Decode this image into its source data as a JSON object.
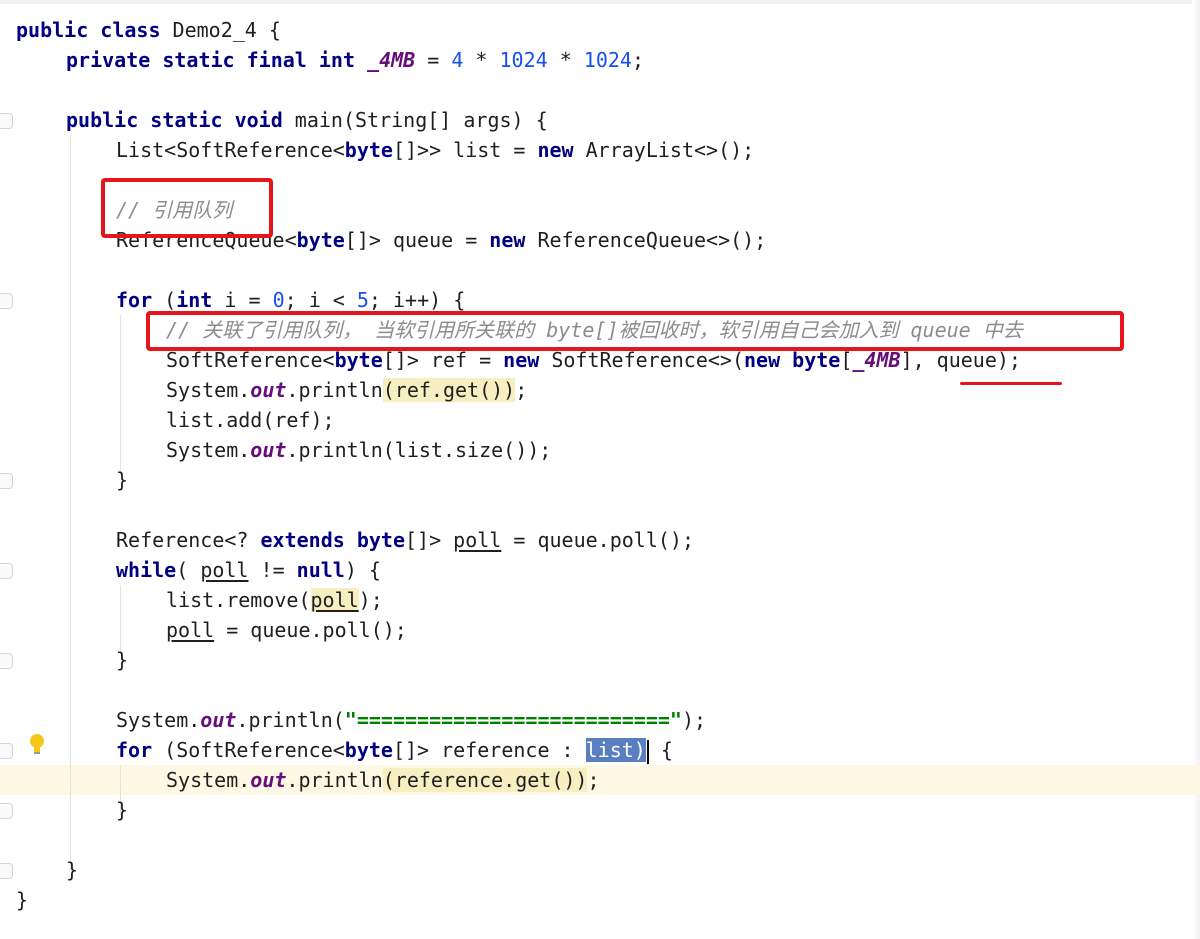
{
  "editor": {
    "language": "java",
    "current_line": 25,
    "lines": [
      {
        "tokens": [
          {
            "t": "public class",
            "c": "kw"
          },
          {
            "t": " Demo2_4 {"
          }
        ]
      },
      {
        "indent": 1,
        "tokens": [
          {
            "t": "private static final int",
            "c": "kw"
          },
          {
            "t": " "
          },
          {
            "t": "_4MB",
            "c": "const"
          },
          {
            "t": " = "
          },
          {
            "t": "4",
            "c": "num"
          },
          {
            "t": " * "
          },
          {
            "t": "1024",
            "c": "num"
          },
          {
            "t": " * "
          },
          {
            "t": "1024",
            "c": "num"
          },
          {
            "t": ";"
          }
        ]
      },
      {
        "tokens": []
      },
      {
        "indent": 1,
        "tokens": [
          {
            "t": "public static void",
            "c": "kw"
          },
          {
            "t": " main(String[] args) {"
          }
        ]
      },
      {
        "indent": 2,
        "tokens": [
          {
            "t": "List<SoftReference<"
          },
          {
            "t": "byte",
            "c": "kw"
          },
          {
            "t": "[]>> list = "
          },
          {
            "t": "new",
            "c": "kw"
          },
          {
            "t": " ArrayList<>();"
          }
        ]
      },
      {
        "tokens": []
      },
      {
        "indent": 2,
        "tokens": [
          {
            "t": "// 引用队列",
            "c": "comment"
          }
        ]
      },
      {
        "indent": 2,
        "tokens": [
          {
            "t": "ReferenceQueue<"
          },
          {
            "t": "byte",
            "c": "kw"
          },
          {
            "t": "[]> queue = "
          },
          {
            "t": "new",
            "c": "kw"
          },
          {
            "t": " ReferenceQueue<>();"
          }
        ]
      },
      {
        "tokens": []
      },
      {
        "indent": 2,
        "tokens": [
          {
            "t": "for",
            "c": "kw"
          },
          {
            "t": " ("
          },
          {
            "t": "int",
            "c": "kw"
          },
          {
            "t": " i = "
          },
          {
            "t": "0",
            "c": "num"
          },
          {
            "t": "; i < "
          },
          {
            "t": "5",
            "c": "num"
          },
          {
            "t": "; i++) {"
          }
        ]
      },
      {
        "indent": 3,
        "tokens": [
          {
            "t": "// 关联了引用队列， 当软引用所关联的 byte[]被回收时，软引用自己会加入到 queue 中去",
            "c": "comment"
          }
        ]
      },
      {
        "indent": 3,
        "tokens": [
          {
            "t": "SoftReference<"
          },
          {
            "t": "byte",
            "c": "kw"
          },
          {
            "t": "[]> ref = "
          },
          {
            "t": "new",
            "c": "kw"
          },
          {
            "t": " SoftReference<>("
          },
          {
            "t": "new",
            "c": "kw"
          },
          {
            "t": " "
          },
          {
            "t": "byte",
            "c": "kw"
          },
          {
            "t": "["
          },
          {
            "t": "_4MB",
            "c": "const"
          },
          {
            "t": "], queue);"
          }
        ]
      },
      {
        "indent": 3,
        "tokens": [
          {
            "t": "System."
          },
          {
            "t": "out",
            "c": "static-field"
          },
          {
            "t": ".println"
          },
          {
            "t": "(ref.get())",
            "c": "hl"
          },
          {
            "t": ";"
          }
        ]
      },
      {
        "indent": 3,
        "tokens": [
          {
            "t": "list.add(ref);"
          }
        ]
      },
      {
        "indent": 3,
        "tokens": [
          {
            "t": "System."
          },
          {
            "t": "out",
            "c": "static-field"
          },
          {
            "t": ".println(list.size());"
          }
        ]
      },
      {
        "indent": 2,
        "tokens": [
          {
            "t": "}"
          }
        ]
      },
      {
        "tokens": []
      },
      {
        "indent": 2,
        "tokens": [
          {
            "t": "Reference<? "
          },
          {
            "t": "extends byte",
            "c": "kw"
          },
          {
            "t": "[]> "
          },
          {
            "t": "poll",
            "c": "under"
          },
          {
            "t": " = queue.poll();"
          }
        ]
      },
      {
        "indent": 2,
        "tokens": [
          {
            "t": "while",
            "c": "kw"
          },
          {
            "t": "( "
          },
          {
            "t": "poll",
            "c": "under"
          },
          {
            "t": " != "
          },
          {
            "t": "null",
            "c": "kw"
          },
          {
            "t": ") {"
          }
        ]
      },
      {
        "indent": 3,
        "tokens": [
          {
            "t": "list.remove("
          },
          {
            "t": "poll",
            "c": "under hl"
          },
          {
            "t": ");"
          }
        ]
      },
      {
        "indent": 3,
        "tokens": [
          {
            "t": "poll",
            "c": "under"
          },
          {
            "t": " = queue.poll();"
          }
        ]
      },
      {
        "indent": 2,
        "tokens": [
          {
            "t": "}"
          }
        ]
      },
      {
        "tokens": []
      },
      {
        "indent": 2,
        "tokens": [
          {
            "t": "System."
          },
          {
            "t": "out",
            "c": "static-field"
          },
          {
            "t": ".println("
          },
          {
            "t": "\"==========================\"",
            "c": "str"
          },
          {
            "t": ");"
          }
        ]
      },
      {
        "indent": 2,
        "tokens": [
          {
            "t": "for",
            "c": "kw"
          },
          {
            "t": " (SoftReference<"
          },
          {
            "t": "byte",
            "c": "kw"
          },
          {
            "t": "[]> reference : "
          },
          {
            "t": "list)",
            "c": "sel"
          },
          {
            "t": "",
            "c": "caret"
          },
          {
            "t": " {"
          }
        ]
      },
      {
        "indent": 3,
        "tokens": [
          {
            "t": "System."
          },
          {
            "t": "out",
            "c": "static-field"
          },
          {
            "t": ".println"
          },
          {
            "t": "(reference.get())",
            "c": "hl"
          },
          {
            "t": ";"
          }
        ]
      },
      {
        "indent": 2,
        "tokens": [
          {
            "t": "}"
          }
        ]
      },
      {
        "tokens": []
      },
      {
        "indent": 1,
        "tokens": [
          {
            "t": "}"
          }
        ]
      },
      {
        "tokens": [
          {
            "t": "}"
          }
        ]
      }
    ]
  },
  "annotations": {
    "box_color": "#e8141b",
    "highlight_color": "#f7eec2",
    "selection_color": "#5a7fc0"
  }
}
